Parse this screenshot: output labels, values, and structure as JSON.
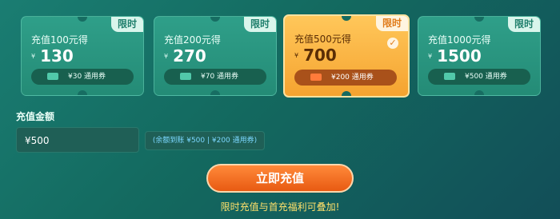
{
  "cards": [
    {
      "title": "充值100元得",
      "yen": "¥",
      "amount": "130",
      "badge": "限时",
      "coupon": "¥30 通用券"
    },
    {
      "title": "充值200元得",
      "yen": "¥",
      "amount": "270",
      "badge": "限时",
      "coupon": "¥70 通用券"
    },
    {
      "title": "充值500元得",
      "yen": "¥",
      "amount": "700",
      "badge": "限时",
      "coupon": "¥200 通用券"
    },
    {
      "title": "充值1000元得",
      "yen": "¥",
      "amount": "1500",
      "badge": "限时",
      "coupon": "¥500 通用券"
    }
  ],
  "form": {
    "label": "充值金额",
    "amount_value": "¥500",
    "hint": "(余额到账 ¥500 | ¥200 通用券)"
  },
  "action": {
    "button_label": "立即充值",
    "note": "限时充值与首充福利可叠加!"
  },
  "colors": {
    "bg": "#136a60",
    "card": "#248b76",
    "selected_card": "#f5a330",
    "button": "#e85a12",
    "note": "#ffe06a"
  },
  "icons": {
    "selected": "check-circle-icon",
    "coupon": "ticket-icon"
  }
}
